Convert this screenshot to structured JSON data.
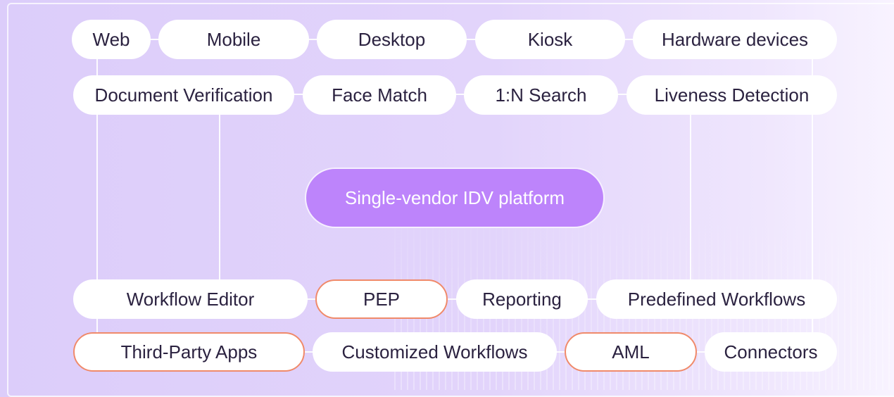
{
  "channels": [
    "Web",
    "Mobile",
    "Desktop",
    "Kiosk",
    "Hardware devices"
  ],
  "capabilities": [
    "Document Verification",
    "Face Match",
    "1:N Search",
    "Liveness Detection"
  ],
  "platform": "Single-vendor IDV platform",
  "features_row1": [
    "Workflow Editor",
    "PEP",
    "Reporting",
    "Predefined Workflows"
  ],
  "features_row2": [
    "Third-Party Apps",
    "Customized Workflows",
    "AML",
    "Connectors"
  ],
  "highlighted": [
    "PEP",
    "Third-Party Apps",
    "AML"
  ],
  "colors": {
    "background": "#dccdfa",
    "pill": "#ffffff",
    "platform_fill": "#bd84fb",
    "highlight_border": "#f08a6a",
    "text": "#2b2240"
  }
}
